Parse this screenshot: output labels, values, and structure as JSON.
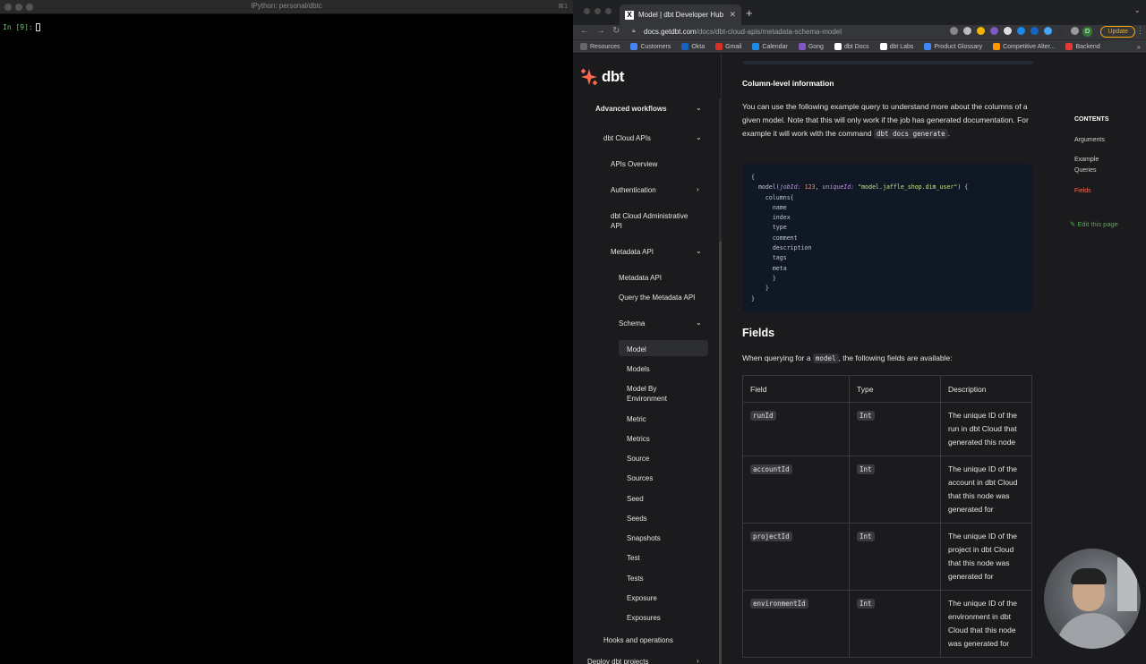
{
  "terminal": {
    "title": "IPython: personal/dbtc",
    "shortcut": "⌘1",
    "prompt": "In [9]:"
  },
  "browser": {
    "tab_title": "Model | dbt Developer Hub",
    "favicon_letter": "X",
    "url_host": "docs.getdbt.com",
    "url_path": "/docs/dbt-cloud-apis/metadata-schema-model",
    "profile_initial": "D",
    "update_label": "Update",
    "bookmarks": [
      "Resources",
      "Customers",
      "Okta",
      "Gmail",
      "Calendar",
      "Gong",
      "dbt Docs",
      "dbt Labs",
      "Product Glossary",
      "Competitive Alter...",
      "Backend"
    ],
    "bookmark_colors": [
      "#666666",
      "#4285f4",
      "#1565c0",
      "#d93025",
      "#1e88e5",
      "#7e57c2",
      "#ffffff",
      "#ffffff",
      "#4285f4",
      "#ff9800",
      "#e53935"
    ]
  },
  "site": {
    "logo_text": "dbt",
    "brand_color": "#ff694b"
  },
  "sidebar": {
    "advanced_workflows": "Advanced workflows",
    "dbt_cloud_apis": "dbt Cloud APIs",
    "apis_overview": "APIs Overview",
    "authentication": "Authentication",
    "admin_api": "dbt Cloud Administrative API",
    "metadata_api": "Metadata API",
    "metadata_api_sub": "Metadata API",
    "query_metadata": "Query the Metadata API",
    "schema": "Schema",
    "schema_items": [
      "Model",
      "Models",
      "Model By Environment",
      "Metric",
      "Metrics",
      "Source",
      "Sources",
      "Seed",
      "Seeds",
      "Snapshots",
      "Test",
      "Tests",
      "Exposure",
      "Exposures"
    ],
    "hooks": "Hooks and operations",
    "deploy": "Deploy dbt projects"
  },
  "content": {
    "column_heading": "Column-level information",
    "para_1": "You can use the following example query to understand more about the columns of a given model. Note that this will only work if the job has generated documentation. For example it will work with the command",
    "para_1_code": "dbt docs generate",
    "para_1_end": ".",
    "code": {
      "open": "{",
      "model_fn": "model(",
      "arg1": "jobId:",
      "arg1_val": "123",
      "arg2": "uniqueId:",
      "arg2_val": "\"model.jaffle_shop.dim_user\"",
      "model_close": ") {",
      "columns": "columns{",
      "fields": [
        "name",
        "index",
        "type",
        "comment",
        "description",
        "tags",
        "meta"
      ],
      "close_columns": "}",
      "close_model": "}",
      "close": "}"
    },
    "fields_heading": "Fields",
    "para_2_pre": "When querying for a",
    "para_2_code": "model",
    "para_2_post": ", the following fields are available:",
    "table": {
      "headers": [
        "Field",
        "Type",
        "Description"
      ],
      "rows": [
        {
          "field": "runId",
          "type": "Int",
          "desc": "The unique ID of the run in dbt Cloud that generated this node"
        },
        {
          "field": "accountId",
          "type": "Int",
          "desc": "The unique ID of the account in dbt Cloud that this node was generated for"
        },
        {
          "field": "projectId",
          "type": "Int",
          "desc": "The unique ID of the project in dbt Cloud that this node was generated for"
        },
        {
          "field": "environmentId",
          "type": "Int",
          "desc": "The unique ID of the environment in dbt Cloud that this node was generated for"
        }
      ]
    }
  },
  "toc": {
    "heading": "CONTENTS",
    "items": [
      "Arguments",
      "Example Queries",
      "Fields"
    ],
    "active": "Fields",
    "edit": "Edit this page"
  }
}
